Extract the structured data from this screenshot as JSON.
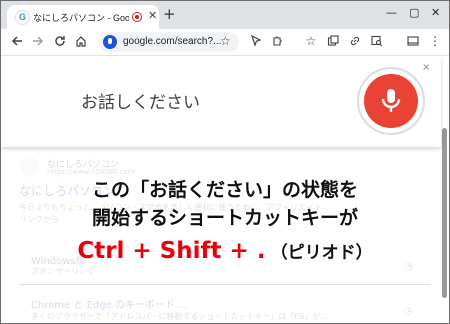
{
  "browser": {
    "tab": {
      "title": "なにしろパソコン - Google 検索",
      "favicon": "G"
    },
    "address": {
      "url": "google.com/search?..."
    }
  },
  "icons": {
    "back": "arrow-left-icon",
    "forward": "arrow-right-icon",
    "reload": "reload-icon",
    "home": "home-icon",
    "security": "site-info-icon",
    "bookmark": "star-icon",
    "mic": "microphone-icon"
  },
  "colors": {
    "mic_button": "#ea4335",
    "shortcut_text": "#e8000b",
    "link": "#1a0dab"
  },
  "voice_search": {
    "prompt": "お話しください",
    "close_symbol": "×"
  },
  "results": {
    "first": {
      "site": "なにしろパソコン",
      "url": "https://www.724685.com",
      "title": "なにしろパソコン",
      "snippet1": "今日よりもちょっと、パソコン・スマホを楽しく便利に使うために。アフィリエイト",
      "snippet2": "リンクから"
    },
    "second": {
      "title": "Windows版",
      "snippet": "スポンサーリンク"
    },
    "third": {
      "title": "Chrome と Edge のキーボード ...",
      "snippet": "多くのブラウザーで「アドレスバーに移動するショートカットキー」は「F6」が..."
    }
  },
  "caption": {
    "line1": "この「お話ください」の状態を",
    "line2": "開始するショートカットキーが",
    "shortcut": "Ctrl + Shift + .",
    "suffix": "（ピリオド）"
  }
}
